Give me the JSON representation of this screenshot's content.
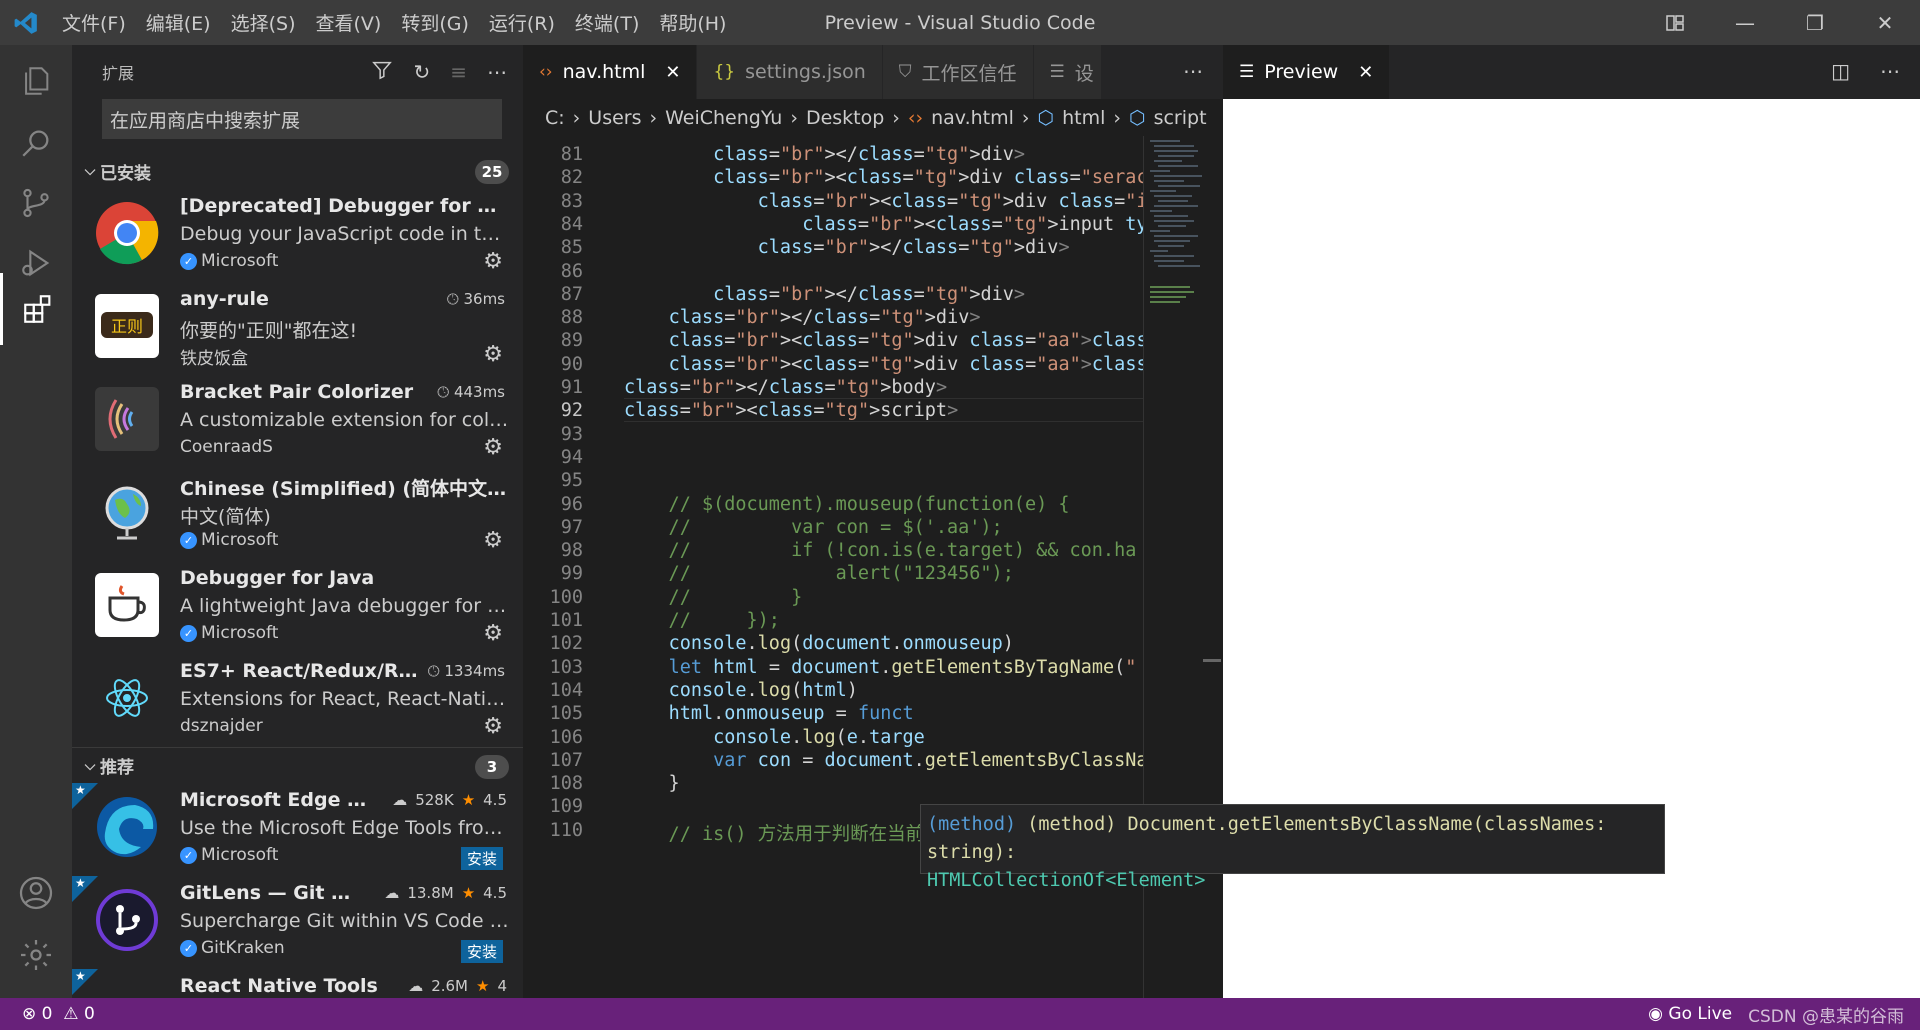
{
  "titlebar": {
    "menu": [
      "文件(F)",
      "编辑(E)",
      "选择(S)",
      "查看(V)",
      "转到(G)",
      "运行(R)",
      "终端(T)",
      "帮助(H)"
    ],
    "title": "Preview - Visual Studio Code"
  },
  "sidebar": {
    "title": "扩展",
    "search_placeholder": "在应用商店中搜索扩展",
    "installed": {
      "label": "已安装",
      "count": "25",
      "items": [
        {
          "name": "[Deprecated] Debugger for Chro...",
          "desc": "Debug your JavaScript code in the ...",
          "publisher": "Microsoft",
          "verified": true,
          "time": ""
        },
        {
          "name": "any-rule",
          "desc": "你要的\"正则\"都在这!",
          "publisher": "铁皮饭盒",
          "verified": false,
          "time": "36ms"
        },
        {
          "name": "Bracket Pair Colorizer",
          "desc": "A customizable extension for coloriz...",
          "publisher": "CoenraadS",
          "verified": false,
          "time": "443ms"
        },
        {
          "name": "Chinese (Simplified) (简体中文) La...",
          "desc": "中文(简体)",
          "publisher": "Microsoft",
          "verified": true,
          "time": ""
        },
        {
          "name": "Debugger for Java",
          "desc": "A lightweight Java debugger for Vis...",
          "publisher": "Microsoft",
          "verified": true,
          "time": ""
        },
        {
          "name": "ES7+ React/Redux/React...",
          "desc": "Extensions for React, React-Native a...",
          "publisher": "dsznajder",
          "verified": false,
          "time": "1334ms"
        }
      ]
    },
    "recommended": {
      "label": "推荐",
      "count": "3",
      "items": [
        {
          "name": "Microsoft Edge Tool...",
          "downloads": "528K",
          "rating": "4.5",
          "desc": "Use the Microsoft Edge Tools from ...",
          "publisher": "Microsoft",
          "install": "安装"
        },
        {
          "name": "GitLens — Git supe...",
          "downloads": "13.8M",
          "rating": "4.5",
          "desc": "Supercharge Git within VS Code — ...",
          "publisher": "GitKraken",
          "install": "安装"
        },
        {
          "name": "React Native Tools",
          "downloads": "2.6M",
          "rating": "4"
        }
      ]
    }
  },
  "editor": {
    "tabs": [
      {
        "label": "nav.html",
        "icon": "html-icon",
        "active": true
      },
      {
        "label": "settings.json",
        "icon": "json-icon",
        "active": false
      },
      {
        "label": "工作区信任",
        "icon": "shield-icon",
        "active": false
      },
      {
        "label": "设",
        "icon": "lines-icon",
        "active": false
      }
    ],
    "breadcrumb": [
      "C:",
      "Users",
      "WeiChengYu",
      "Desktop",
      "nav.html",
      "html",
      "script"
    ],
    "current_line": 92,
    "lines": [
      {
        "n": "81",
        "t": "        </div>"
      },
      {
        "n": "82",
        "t": "        <div class=\"serachBox\">"
      },
      {
        "n": "83",
        "t": "            <div class=\"inpBox\">"
      },
      {
        "n": "84",
        "t": "                <input type=\"text\" class=\"inp\"><b"
      },
      {
        "n": "85",
        "t": "            </div>"
      },
      {
        "n": "86",
        "t": ""
      },
      {
        "n": "87",
        "t": "        </div>"
      },
      {
        "n": "88",
        "t": "    </div>"
      },
      {
        "n": "89",
        "t": "    <div class=\"aa\"></div>"
      },
      {
        "n": "90",
        "t": "    <div class=\"aa\"></div>"
      },
      {
        "n": "91",
        "t": "</body>"
      },
      {
        "n": "92",
        "t": "<script>"
      },
      {
        "n": "93",
        "t": ""
      },
      {
        "n": "94",
        "t": ""
      },
      {
        "n": "95",
        "t": ""
      },
      {
        "n": "96",
        "t": "    // $(document).mouseup(function(e) {"
      },
      {
        "n": "97",
        "t": "    //         var con = $('.aa');"
      },
      {
        "n": "98",
        "t": "    //         if (!con.is(e.target) && con.ha"
      },
      {
        "n": "99",
        "t": "    //             alert(\"123456\");"
      },
      {
        "n": "100",
        "t": "    //         }"
      },
      {
        "n": "101",
        "t": "    //     });"
      },
      {
        "n": "102",
        "t": "    console.log(document.onmouseup)"
      },
      {
        "n": "103",
        "t": "    let html = document.getElementsByTagName(\""
      },
      {
        "n": "104",
        "t": "    console.log(html)"
      },
      {
        "n": "105",
        "t": "    html.onmouseup = funct"
      },
      {
        "n": "106",
        "t": "        console.log(e.targe"
      },
      {
        "n": "107",
        "t": "        var con = document.getElementsByClassNa"
      },
      {
        "n": "108",
        "t": "    }"
      },
      {
        "n": "109",
        "t": ""
      },
      {
        "n": "110",
        "t": "    // is() 方法用于判断在当前选择的元素集合中是否"
      }
    ],
    "hover": {
      "line1": "(method) Document.getElementsByClassName(classNames: string):",
      "line2": "HTMLCollectionOf<Element>"
    }
  },
  "preview": {
    "tab_label": "Preview"
  },
  "statusbar": {
    "errors": "0",
    "warnings": "0",
    "go_live": "Go Live",
    "watermark": "CSDN @患某的谷雨"
  },
  "colors": {
    "statusbar": "#68217a",
    "accent": "#0e639c"
  }
}
